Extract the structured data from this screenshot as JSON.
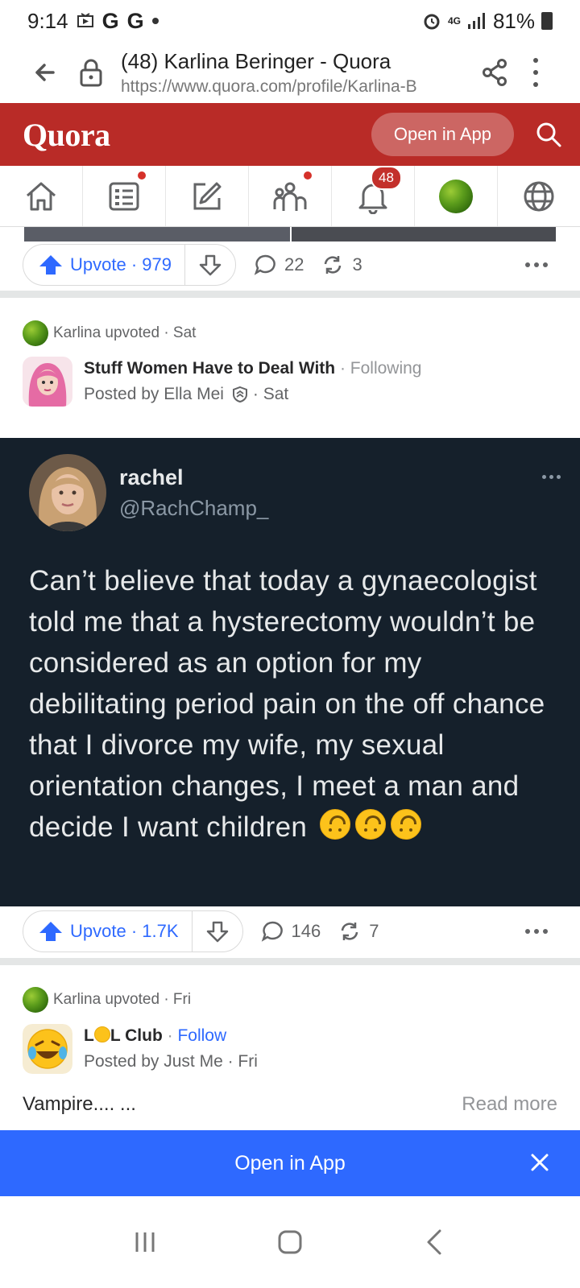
{
  "status_bar": {
    "time": "9:14",
    "g1": "G",
    "g2": "G",
    "network": "4G",
    "battery": "81%"
  },
  "browser": {
    "tab_title": "(48) Karlina Beringer - Quora",
    "url": "https://www.quora.com/profile/Karlina-B"
  },
  "quora_header": {
    "logo": "Quora",
    "open_in_app": "Open in App"
  },
  "nav": {
    "notifications_count": "48"
  },
  "post1": {
    "upvote_label": "Upvote · 979",
    "comments": "22",
    "shares": "3"
  },
  "post2": {
    "activity": "Karlina upvoted · Sat",
    "space_name": "Stuff Women Have to Deal With",
    "separator": " · ",
    "follow_state": "Following",
    "posted_by": "Posted by Ella Mei",
    "posted_when": "· Sat",
    "tweet": {
      "name": "rachel",
      "handle": "@RachChamp_",
      "text": "Can’t believe that today a gynaecologist told me that a hysterectomy wouldn’t be considered as an option for my debilitating period pain on the off chance that I divorce my wife, my sexual orientation changes, I meet a man and decide I want children"
    },
    "upvote_label": "Upvote · 1.7K",
    "comments": "146",
    "shares": "7"
  },
  "post3": {
    "activity": "Karlina upvoted · Fri",
    "space_name_pre": "L",
    "space_name_post": "L Club",
    "separator": " · ",
    "follow_state": "Follow",
    "posted_by": "Posted by Just Me · Fri",
    "excerpt": "Vampire.... ...",
    "read_more": "Read more"
  },
  "bottom_banner": {
    "label": "Open in App"
  },
  "colors": {
    "quora_red": "#b92b27",
    "upvote_blue": "#2e69ff",
    "tweet_bg": "#15202b"
  }
}
